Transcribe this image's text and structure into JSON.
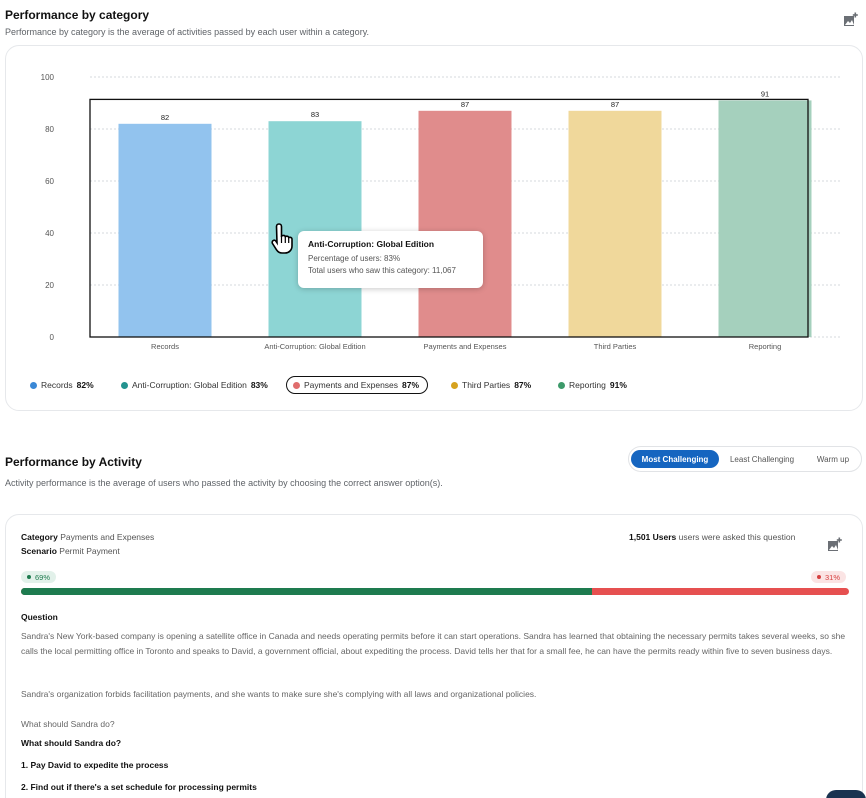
{
  "category_section": {
    "title": "Performance by category",
    "subtitle": "Performance by category is the average of activities passed by each user within a category.",
    "export_icon": "add-image-icon"
  },
  "chart_data": {
    "type": "bar",
    "categories": [
      "Records",
      "Anti-Corruption: Global Edition",
      "Payments and Expenses",
      "Third Parties",
      "Reporting"
    ],
    "values": [
      82,
      83,
      87,
      87,
      91
    ],
    "colors": [
      "#92c3ee",
      "#8dd5d4",
      "#e08c8c",
      "#f0d89b",
      "#a5d0bd"
    ],
    "ylim": [
      0,
      100
    ],
    "yticks": [
      0,
      20,
      40,
      60,
      80,
      100
    ],
    "grid": true,
    "legend_placement": "bottom-left"
  },
  "legend": [
    {
      "label": "Records",
      "value": "82%",
      "color": "#3a88d6"
    },
    {
      "label": "Anti-Corruption: Global Edition",
      "value": "83%",
      "color": "#24938f"
    },
    {
      "label": "Payments and Expenses",
      "value": "87%",
      "color": "#e06d6d"
    },
    {
      "label": "Third Parties",
      "value": "87%",
      "color": "#d6a21e"
    },
    {
      "label": "Reporting",
      "value": "91%",
      "color": "#3d9a6a"
    }
  ],
  "legend_selected": "Payments and Expenses",
  "tooltip": {
    "title": "Anti-Corruption: Global Edition",
    "line1": "Percentage of users: 83%",
    "line2": "Total users who saw this category: 11,067"
  },
  "activity_section": {
    "title": "Performance by Activity",
    "subtitle": "Activity performance is the average of users who passed the activity by choosing the correct answer option(s).",
    "tabs": [
      "Most Challenging",
      "Least Challenging",
      "Warm up"
    ],
    "active_tab": "Most Challenging"
  },
  "activity_card": {
    "category_label": "Category",
    "category_value": "Payments and Expenses",
    "scenario_label": "Scenario",
    "scenario_value": "Permit Payment",
    "users_count": "1,501 Users",
    "users_text": "users were asked this question",
    "pass_pct": "69%",
    "fail_pct": "31%",
    "pass_fraction": 0.69,
    "pass_color": "#1e7b4f",
    "fail_color": "#e65050",
    "question_label": "Question",
    "paragraph1": "Sandra's New York-based company is opening a satellite office in Canada and needs operating permits before it can start operations. Sandra has learned that obtaining the necessary permits takes several weeks, so she calls the local permitting office in Toronto and speaks to David, a government official, about expediting the process. David tells her that for a small fee, he can have the permits ready within five to seven business days.",
    "paragraph2": "Sandra's organization forbids facilitation payments, and she wants to make sure she's complying with all laws and organizational policies.",
    "prompt_light": "What should Sandra do?",
    "prompt_bold": "What should Sandra do?",
    "option1": "1. Pay David to expedite the process",
    "option2": "2. Find out if there's a set schedule for processing permits"
  }
}
